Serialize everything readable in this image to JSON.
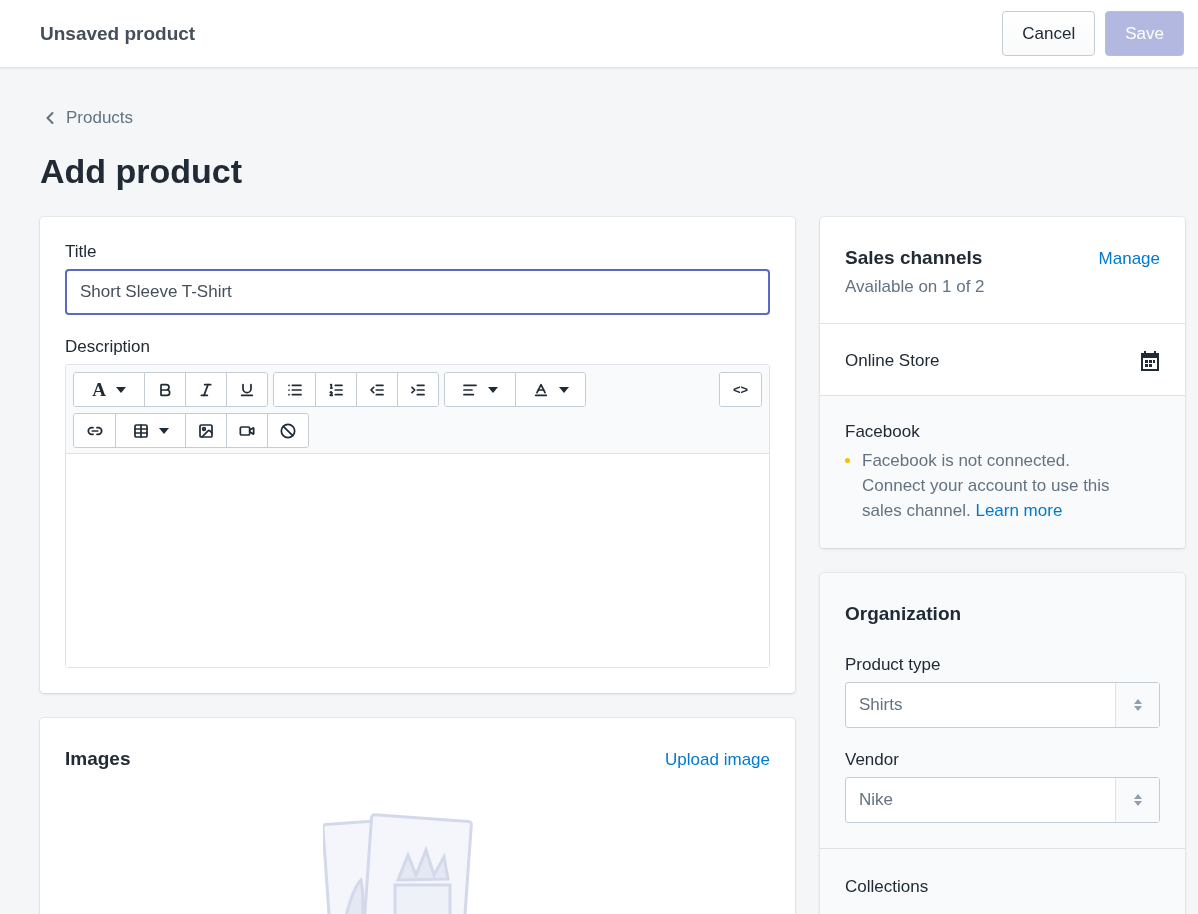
{
  "top_bar": {
    "title": "Unsaved product",
    "buttons": [
      {
        "label": "Cancel",
        "kind": "secondary",
        "disabled": false
      },
      {
        "label": "Save",
        "kind": "primary",
        "disabled": true
      }
    ]
  },
  "breadcrumb": "Products",
  "page_title": "Add product",
  "product_card": {
    "title_field": {
      "label": "Title",
      "value": "Short Sleeve T-Shirt",
      "focused": true
    },
    "description": {
      "label": "Description",
      "toolbar_rows": [
        [
          {
            "kind": "format",
            "buttons": [
              {
                "kind": "font",
                "dropdown": true,
                "label": "A"
              },
              {
                "kind": "bold",
                "dropdown": false
              },
              {
                "kind": "italic",
                "dropdown": false
              },
              {
                "kind": "underline",
                "dropdown": false
              }
            ]
          },
          {
            "kind": "format",
            "buttons": [
              {
                "kind": "bullets",
                "dropdown": false
              },
              {
                "kind": "numbers",
                "dropdown": false
              },
              {
                "kind": "outdent",
                "dropdown": false
              },
              {
                "kind": "indent",
                "dropdown": false
              }
            ]
          },
          {
            "kind": "format",
            "buttons": [
              {
                "kind": "align",
                "dropdown": true
              },
              {
                "kind": "color",
                "dropdown": true
              }
            ]
          },
          {
            "kind": "code",
            "buttons": [
              {
                "kind": "code",
                "dropdown": false,
                "label": "<>"
              }
            ]
          }
        ],
        [
          {
            "kind": "format",
            "buttons": [
              {
                "kind": "link",
                "dropdown": false
              },
              {
                "kind": "table",
                "dropdown": true
              },
              {
                "kind": "image",
                "dropdown": false
              },
              {
                "kind": "video",
                "dropdown": false
              },
              {
                "kind": "clear",
                "dropdown": false
              }
            ]
          }
        ]
      ]
    }
  },
  "images_card": {
    "title": "Images",
    "action": "Upload image"
  },
  "sales_channels": {
    "title": "Sales channels",
    "action": "Manage",
    "subtitle": "Available on 1 of 2",
    "channels": [
      {
        "name": "Online Store",
        "kind": "scheduled"
      },
      {
        "name": "Facebook",
        "kind": "warning",
        "message": "Facebook is not connected. Connect your account to use this sales channel.",
        "link": "Learn more",
        "color": "#eec200"
      }
    ]
  },
  "organization": {
    "title": "Organization",
    "fields": [
      {
        "label": "Product type",
        "value": "Shirts"
      },
      {
        "label": "Vendor",
        "value": "Nike"
      }
    ],
    "collections_label": "Collections"
  }
}
